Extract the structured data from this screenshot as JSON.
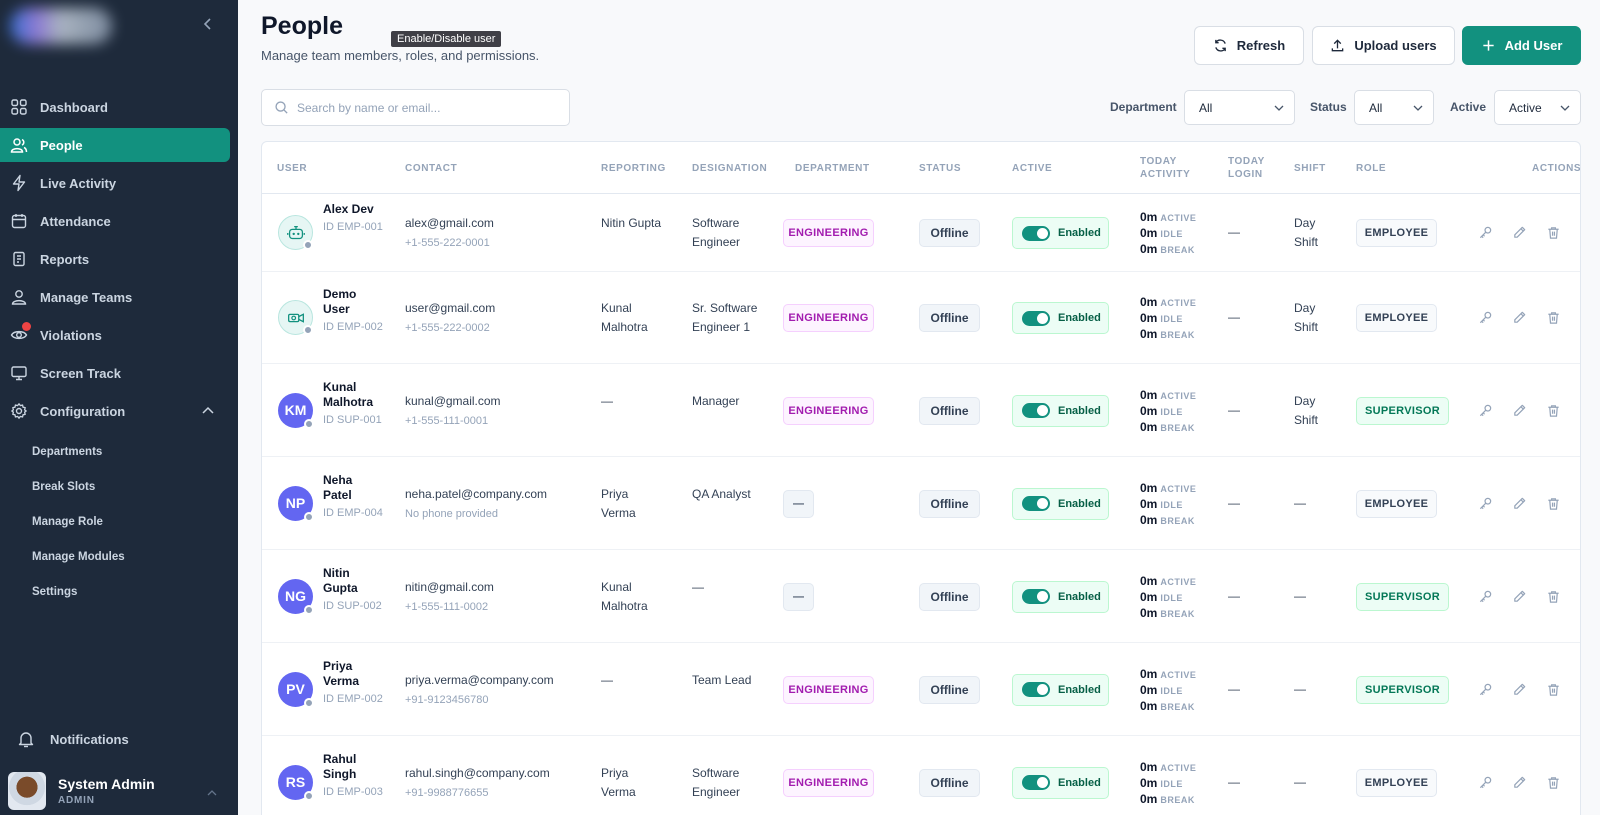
{
  "sidebar": {
    "nav": [
      {
        "label": "Dashboard",
        "icon": "grid-icon"
      },
      {
        "label": "People",
        "icon": "users-icon",
        "active": true
      },
      {
        "label": "Live Activity",
        "icon": "bolt-icon"
      },
      {
        "label": "Attendance",
        "icon": "calendar-icon"
      },
      {
        "label": "Reports",
        "icon": "report-icon"
      },
      {
        "label": "Manage Teams",
        "icon": "team-icon"
      },
      {
        "label": "Violations",
        "icon": "eye-icon"
      },
      {
        "label": "Screen Track",
        "icon": "monitor-icon"
      },
      {
        "label": "Configuration",
        "icon": "gear-icon"
      }
    ],
    "sub_items": [
      "Departments",
      "Break Slots",
      "Manage Role",
      "Manage Modules",
      "Settings"
    ],
    "notifications_label": "Notifications",
    "user": {
      "name": "System Admin",
      "role": "ADMIN"
    }
  },
  "header": {
    "title": "People",
    "subtitle": "Manage team members, roles, and permissions.",
    "tooltip": "Enable/Disable user",
    "refresh_label": "Refresh",
    "upload_label": "Upload users",
    "add_label": "Add User"
  },
  "filters": {
    "search_placeholder": "Search by name or email...",
    "department_label": "Department",
    "department_value": "All",
    "status_label": "Status",
    "status_value": "All",
    "active_label": "Active",
    "active_value": "Active"
  },
  "table": {
    "headers": {
      "user": "USER",
      "contact": "CONTACT",
      "reporting": "REPORTING",
      "designation": "DESIGNATION",
      "department": "DEPARTMENT",
      "status": "STATUS",
      "active": "ACTIVE",
      "today_activity": "TODAY ACTIVITY",
      "today_login": "TODAY LOGIN",
      "shift": "SHIFT",
      "role": "ROLE",
      "actions": "ACTIONS"
    },
    "activity_labels": {
      "active": "ACTIVE",
      "idle": "IDLE",
      "break": "BREAK"
    },
    "rows": [
      {
        "name": "Alex Dev",
        "id": "ID EMP-001",
        "avatar": "robot-icon",
        "email": "alex@gmail.com",
        "phone": "+1-555-222-0001",
        "reporting": "Nitin Gupta",
        "designation": "Software Engineer",
        "department": "ENGINEERING",
        "status": "Offline",
        "active": "Enabled",
        "act_active": "0m",
        "act_idle": "0m",
        "act_break": "0m",
        "login": "—",
        "shift": "Day Shift",
        "role": "EMPLOYEE"
      },
      {
        "name": "Demo User",
        "id": "ID EMP-002",
        "avatar": "camera-icon",
        "email": "user@gmail.com",
        "phone": "+1-555-222-0002",
        "reporting": "Kunal Malhotra",
        "designation": "Sr. Software Engineer 1",
        "department": "ENGINEERING",
        "status": "Offline",
        "active": "Enabled",
        "act_active": "0m",
        "act_idle": "0m",
        "act_break": "0m",
        "login": "—",
        "shift": "Day Shift",
        "role": "EMPLOYEE"
      },
      {
        "name": "Kunal Malhotra",
        "id": "ID SUP-001",
        "initials": "KM",
        "email": "kunal@gmail.com",
        "phone": "+1-555-111-0001",
        "reporting": "—",
        "designation": "Manager",
        "department": "ENGINEERING",
        "status": "Offline",
        "active": "Enabled",
        "act_active": "0m",
        "act_idle": "0m",
        "act_break": "0m",
        "login": "—",
        "shift": "Day Shift",
        "role": "SUPERVISOR"
      },
      {
        "name": "Neha Patel",
        "id": "ID EMP-004",
        "initials": "NP",
        "email": "neha.patel@company.com",
        "phone": "No phone provided",
        "reporting": "Priya Verma",
        "designation": "QA Analyst",
        "department": "—",
        "status": "Offline",
        "active": "Enabled",
        "act_active": "0m",
        "act_idle": "0m",
        "act_break": "0m",
        "login": "—",
        "shift": "—",
        "role": "EMPLOYEE"
      },
      {
        "name": "Nitin Gupta",
        "id": "ID SUP-002",
        "initials": "NG",
        "email": "nitin@gmail.com",
        "phone": "+1-555-111-0002",
        "reporting": "Kunal Malhotra",
        "designation": "—",
        "department": "—",
        "status": "Offline",
        "active": "Enabled",
        "act_active": "0m",
        "act_idle": "0m",
        "act_break": "0m",
        "login": "—",
        "shift": "—",
        "role": "SUPERVISOR"
      },
      {
        "name": "Priya Verma",
        "id": "ID EMP-002",
        "initials": "PV",
        "email": "priya.verma@company.com",
        "phone": "+91-9123456780",
        "reporting": "—",
        "designation": "Team Lead",
        "department": "ENGINEERING",
        "status": "Offline",
        "active": "Enabled",
        "act_active": "0m",
        "act_idle": "0m",
        "act_break": "0m",
        "login": "—",
        "shift": "—",
        "role": "SUPERVISOR"
      },
      {
        "name": "Rahul Singh",
        "id": "ID EMP-003",
        "initials": "RS",
        "email": "rahul.singh@company.com",
        "phone": "+91-9988776655",
        "reporting": "Priya Verma",
        "designation": "Software Engineer",
        "department": "ENGINEERING",
        "status": "Offline",
        "active": "Enabled",
        "act_active": "0m",
        "act_idle": "0m",
        "act_break": "0m",
        "login": "—",
        "shift": "—",
        "role": "EMPLOYEE"
      }
    ]
  },
  "colors": {
    "sidebar_bg": "#1e2a3b",
    "accent": "#12917f",
    "avatar_initials_bg": "#6366f1",
    "department_text": "#a21caf"
  }
}
